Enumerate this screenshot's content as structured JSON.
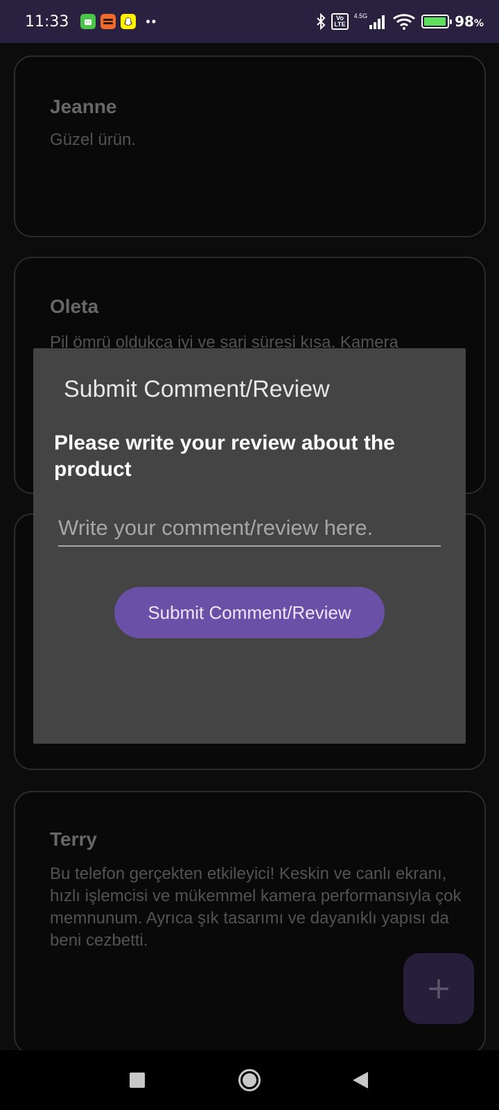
{
  "status_bar": {
    "time": "11:33",
    "network": "4.5G",
    "volte": "Vo LTE",
    "battery_percent": "98",
    "battery_level": 0.98,
    "battery_suffix": "%"
  },
  "reviews": [
    {
      "name": "Jeanne",
      "text": "Güzel ürün."
    },
    {
      "name": "Oleta",
      "text": "Pil ömrü oldukça iyi ve şarj süresi kısa. Kamera"
    },
    {
      "name": "",
      "text": ""
    },
    {
      "name": "Terry",
      "text": "Bu telefon gerçekten etkileyici! Keskin ve canlı ekranı, hızlı işlemcisi ve mükemmel kamera performansıyla çok memnunum. Ayrıca şık tasarımı ve dayanıklı yapısı da beni cezbetti."
    }
  ],
  "dialog": {
    "title": "Submit Comment/Review",
    "prompt": "Please write your review about the product",
    "input_placeholder": "Write your comment/review here.",
    "input_value": "",
    "submit_label": "Submit Comment/Review"
  },
  "fab": {
    "icon": "plus-icon"
  },
  "colors": {
    "status_bar": "#2a2140",
    "accent": "#6a50a7",
    "dialog_bg": "#444444",
    "fab_bg": "#34284f"
  }
}
